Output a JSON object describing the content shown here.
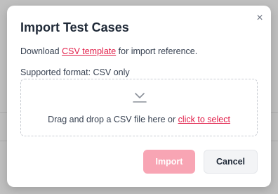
{
  "dialog": {
    "title": "Import Test Cases",
    "close_glyph": "×",
    "download_prefix": "Download ",
    "template_link": "CSV template",
    "download_suffix": " for import reference.",
    "supported_format": "Supported format: CSV only",
    "dropzone": {
      "icon": "download-tray-icon",
      "text_prefix": "Drag and drop a CSV file here or ",
      "select_link": "click to select"
    },
    "buttons": {
      "import_label": "Import",
      "cancel_label": "Cancel"
    },
    "colors": {
      "accent": "#e11d48",
      "import_disabled_bg": "#f8a5b4"
    }
  }
}
